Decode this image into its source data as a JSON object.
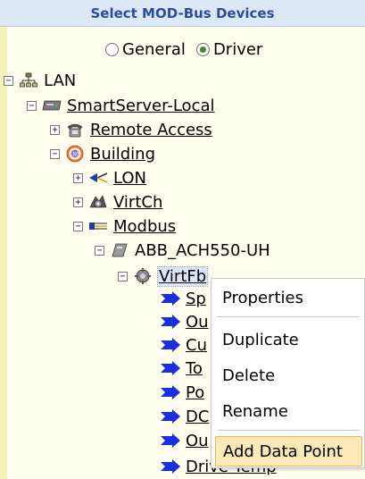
{
  "header": {
    "title": "Select MOD-Bus Devices"
  },
  "view_mode": {
    "options": [
      {
        "label": "General",
        "selected": false
      },
      {
        "label": "Driver",
        "selected": true
      }
    ]
  },
  "tree": {
    "lan": "LAN",
    "smartserver": "SmartServer-Local",
    "remote_access": "Remote Access",
    "building": "Building",
    "lon": "LON",
    "virtch": "VirtCh",
    "modbus": "Modbus",
    "device": "ABB_ACH550-UH",
    "virtfb": "VirtFb",
    "datapoints": [
      "Sp",
      "Ou",
      "Cu",
      "To",
      "Po",
      "DC",
      "Ou",
      "Drive Temp"
    ]
  },
  "context_menu": {
    "items": [
      "Properties",
      "Duplicate",
      "Delete",
      "Rename",
      "Add Data Point"
    ],
    "highlighted": "Add Data Point"
  },
  "colors": {
    "header_text": "#2b4d9f",
    "arrow": "#1a2fe0",
    "menu_highlight": "#fde9b8"
  }
}
